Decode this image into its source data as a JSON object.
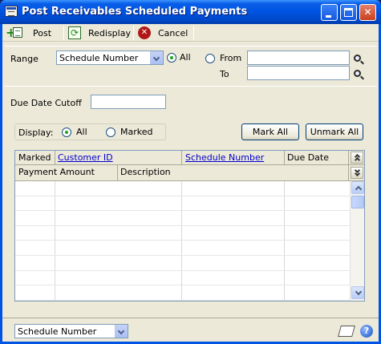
{
  "window": {
    "title": "Post Receivables Scheduled Payments",
    "controls": {
      "minimize": "minimize",
      "maximize": "maximize",
      "close": "✕"
    }
  },
  "toolbar": {
    "post_label": "Post",
    "redisplay_label": "Redisplay",
    "cancel_label": "Cancel"
  },
  "range": {
    "label": "Range",
    "selected": "Schedule Number",
    "all_label": "All",
    "all_selected": true,
    "from_label": "From",
    "from_value": "",
    "to_label": "To",
    "to_value": ""
  },
  "cutoff": {
    "label": "Due Date Cutoff",
    "value": ""
  },
  "display": {
    "label": "Display:",
    "all_label": "All",
    "marked_label": "Marked",
    "selected": "All"
  },
  "buttons": {
    "mark_all": "Mark All",
    "unmark_all": "Unmark All"
  },
  "grid": {
    "headers_row1": [
      "Marked",
      "Customer ID",
      "Schedule Number",
      "Due Date"
    ],
    "headers_row2": [
      "Payment Amount",
      "Description"
    ],
    "rows": [
      [],
      [],
      [],
      [],
      [],
      [],
      [],
      []
    ]
  },
  "footer": {
    "sort_selected": "Schedule Number",
    "help_label": "?"
  },
  "colors": {
    "title_bar": "#0054e3",
    "dialog_bg": "#ece9d8",
    "link": "#0000cc",
    "cancel_icon": "#b01818",
    "accent_green": "#21a121"
  }
}
